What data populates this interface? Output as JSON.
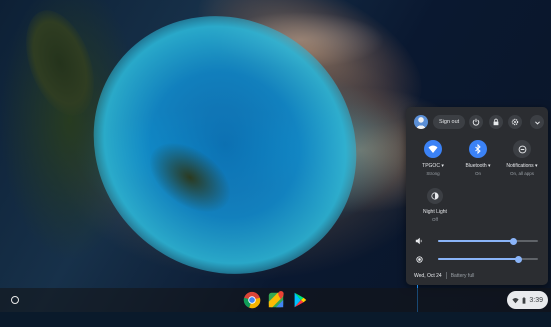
{
  "panel": {
    "sign_out_label": "Sign out",
    "tiles": [
      {
        "label": "TPGOC",
        "sub": "Strong",
        "icon": "wifi-icon",
        "state": "on"
      },
      {
        "label": "Bluetooth",
        "sub": "On",
        "icon": "bluetooth-icon",
        "state": "on"
      },
      {
        "label": "Notifications",
        "sub": "On, all apps",
        "icon": "notifications-icon",
        "state": "off"
      }
    ],
    "night_light": {
      "label": "Night Light",
      "sub": "Off"
    },
    "volume_level": 0.75,
    "brightness_level": 0.8,
    "date": "Wed, Oct 24",
    "battery": "Battery full"
  },
  "shelf": {
    "apps": [
      "chrome-icon",
      "google-maps-icon",
      "play-store-icon"
    ],
    "time": "3:39"
  },
  "colors": {
    "accent": "#3b82f6",
    "panel_bg": "#2b2d31",
    "slider": "#8ab4f8"
  }
}
